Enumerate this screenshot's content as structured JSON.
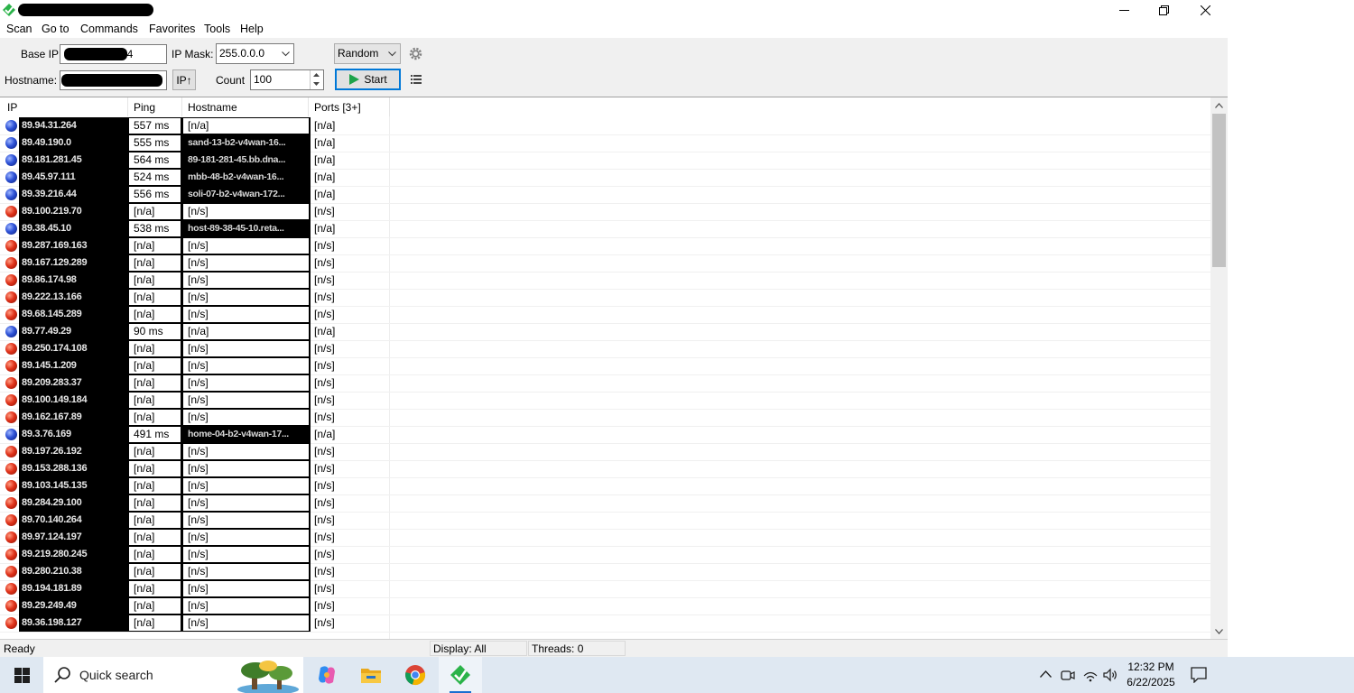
{
  "menu": [
    "Scan",
    "Go to",
    "Commands",
    "Favorites",
    "Tools",
    "Help"
  ],
  "toolbar": {
    "base_ip_label": "Base IP:",
    "base_ip_visible_suffix": "24",
    "ip_mask_label": "IP Mask:",
    "ip_mask_value": "255.0.0.0",
    "mode_value": "Random",
    "hostname_label": "Hostname:",
    "ip_up_button": "IP↑",
    "count_label": "Count",
    "count_value": "100",
    "start_button": "Start"
  },
  "columns": [
    "IP",
    "Ping",
    "Hostname",
    "Ports [3+]"
  ],
  "rows": [
    {
      "status": "alive",
      "ip": "89.94.31.264",
      "ping": "557 ms",
      "hostname": "[n/a]",
      "host_redacted": false,
      "ports": "[n/a]"
    },
    {
      "status": "alive",
      "ip": "89.49.190.0",
      "ping": "555 ms",
      "hostname": "sand-13-b2-v4wan-16...",
      "host_redacted": true,
      "ports": "[n/a]"
    },
    {
      "status": "alive",
      "ip": "89.181.281.45",
      "ping": "564 ms",
      "hostname": "89-181-281-45.bb.dna...",
      "host_redacted": true,
      "ports": "[n/a]"
    },
    {
      "status": "alive",
      "ip": "89.45.97.111",
      "ping": "524 ms",
      "hostname": "mbb-48-b2-v4wan-16...",
      "host_redacted": true,
      "ports": "[n/a]"
    },
    {
      "status": "alive",
      "ip": "89.39.216.44",
      "ping": "556 ms",
      "hostname": "soli-07-b2-v4wan-172...",
      "host_redacted": true,
      "ports": "[n/a]"
    },
    {
      "status": "dead",
      "ip": "89.100.219.70",
      "ping": "[n/a]",
      "hostname": "[n/s]",
      "host_redacted": false,
      "ports": "[n/s]"
    },
    {
      "status": "alive",
      "ip": "89.38.45.10",
      "ping": "538 ms",
      "hostname": "host-89-38-45-10.reta...",
      "host_redacted": true,
      "ports": "[n/a]"
    },
    {
      "status": "dead",
      "ip": "89.287.169.163",
      "ping": "[n/a]",
      "hostname": "[n/s]",
      "host_redacted": false,
      "ports": "[n/s]"
    },
    {
      "status": "dead",
      "ip": "89.167.129.289",
      "ping": "[n/a]",
      "hostname": "[n/s]",
      "host_redacted": false,
      "ports": "[n/s]"
    },
    {
      "status": "dead",
      "ip": "89.86.174.98",
      "ping": "[n/a]",
      "hostname": "[n/s]",
      "host_redacted": false,
      "ports": "[n/s]"
    },
    {
      "status": "dead",
      "ip": "89.222.13.166",
      "ping": "[n/a]",
      "hostname": "[n/s]",
      "host_redacted": false,
      "ports": "[n/s]"
    },
    {
      "status": "dead",
      "ip": "89.68.145.289",
      "ping": "[n/a]",
      "hostname": "[n/s]",
      "host_redacted": false,
      "ports": "[n/s]"
    },
    {
      "status": "alive",
      "ip": "89.77.49.29",
      "ping": "90 ms",
      "hostname": "[n/a]",
      "host_redacted": false,
      "ports": "[n/a]"
    },
    {
      "status": "dead",
      "ip": "89.250.174.108",
      "ping": "[n/a]",
      "hostname": "[n/s]",
      "host_redacted": false,
      "ports": "[n/s]"
    },
    {
      "status": "dead",
      "ip": "89.145.1.209",
      "ping": "[n/a]",
      "hostname": "[n/s]",
      "host_redacted": false,
      "ports": "[n/s]"
    },
    {
      "status": "dead",
      "ip": "89.209.283.37",
      "ping": "[n/a]",
      "hostname": "[n/s]",
      "host_redacted": false,
      "ports": "[n/s]"
    },
    {
      "status": "dead",
      "ip": "89.100.149.184",
      "ping": "[n/a]",
      "hostname": "[n/s]",
      "host_redacted": false,
      "ports": "[n/s]"
    },
    {
      "status": "dead",
      "ip": "89.162.167.89",
      "ping": "[n/a]",
      "hostname": "[n/s]",
      "host_redacted": false,
      "ports": "[n/s]"
    },
    {
      "status": "alive",
      "ip": "89.3.76.169",
      "ping": "491 ms",
      "hostname": "home-04-b2-v4wan-17...",
      "host_redacted": true,
      "ports": "[n/a]"
    },
    {
      "status": "dead",
      "ip": "89.197.26.192",
      "ping": "[n/a]",
      "hostname": "[n/s]",
      "host_redacted": false,
      "ports": "[n/s]"
    },
    {
      "status": "dead",
      "ip": "89.153.288.136",
      "ping": "[n/a]",
      "hostname": "[n/s]",
      "host_redacted": false,
      "ports": "[n/s]"
    },
    {
      "status": "dead",
      "ip": "89.103.145.135",
      "ping": "[n/a]",
      "hostname": "[n/s]",
      "host_redacted": false,
      "ports": "[n/s]"
    },
    {
      "status": "dead",
      "ip": "89.284.29.100",
      "ping": "[n/a]",
      "hostname": "[n/s]",
      "host_redacted": false,
      "ports": "[n/s]"
    },
    {
      "status": "dead",
      "ip": "89.70.140.264",
      "ping": "[n/a]",
      "hostname": "[n/s]",
      "host_redacted": false,
      "ports": "[n/s]"
    },
    {
      "status": "dead",
      "ip": "89.97.124.197",
      "ping": "[n/a]",
      "hostname": "[n/s]",
      "host_redacted": false,
      "ports": "[n/s]"
    },
    {
      "status": "dead",
      "ip": "89.219.280.245",
      "ping": "[n/a]",
      "hostname": "[n/s]",
      "host_redacted": false,
      "ports": "[n/s]"
    },
    {
      "status": "dead",
      "ip": "89.280.210.38",
      "ping": "[n/a]",
      "hostname": "[n/s]",
      "host_redacted": false,
      "ports": "[n/s]"
    },
    {
      "status": "dead",
      "ip": "89.194.181.89",
      "ping": "[n/a]",
      "hostname": "[n/s]",
      "host_redacted": false,
      "ports": "[n/s]"
    },
    {
      "status": "dead",
      "ip": "89.29.249.49",
      "ping": "[n/a]",
      "hostname": "[n/s]",
      "host_redacted": false,
      "ports": "[n/s]"
    },
    {
      "status": "dead",
      "ip": "89.36.198.127",
      "ping": "[n/a]",
      "hostname": "[n/s]",
      "host_redacted": false,
      "ports": "[n/s]"
    }
  ],
  "status": {
    "ready": "Ready",
    "display": "Display: All",
    "threads": "Threads: 0"
  },
  "taskbar": {
    "search_label": "Quick search",
    "time": "12:32 PM",
    "date": "6/22/2025"
  },
  "colors": {
    "alive": "#2d51d6",
    "dead": "#e0321a",
    "start_border": "#0078d7",
    "start_play": "#1ea34a"
  },
  "icons": [
    "app-logo-icon",
    "minimize-icon",
    "restore-icon",
    "close-icon",
    "dropdown-arrow-icon",
    "gear-icon",
    "play-icon",
    "list-icon",
    "scroll-up-icon",
    "scroll-down-icon",
    "windows-start-icon",
    "search-icon",
    "copilot-icon",
    "file-explorer-icon",
    "chrome-icon",
    "angry-ip-scanner-icon",
    "chevron-up-icon",
    "meet-now-icon",
    "network-icon",
    "volume-icon",
    "notification-icon"
  ]
}
